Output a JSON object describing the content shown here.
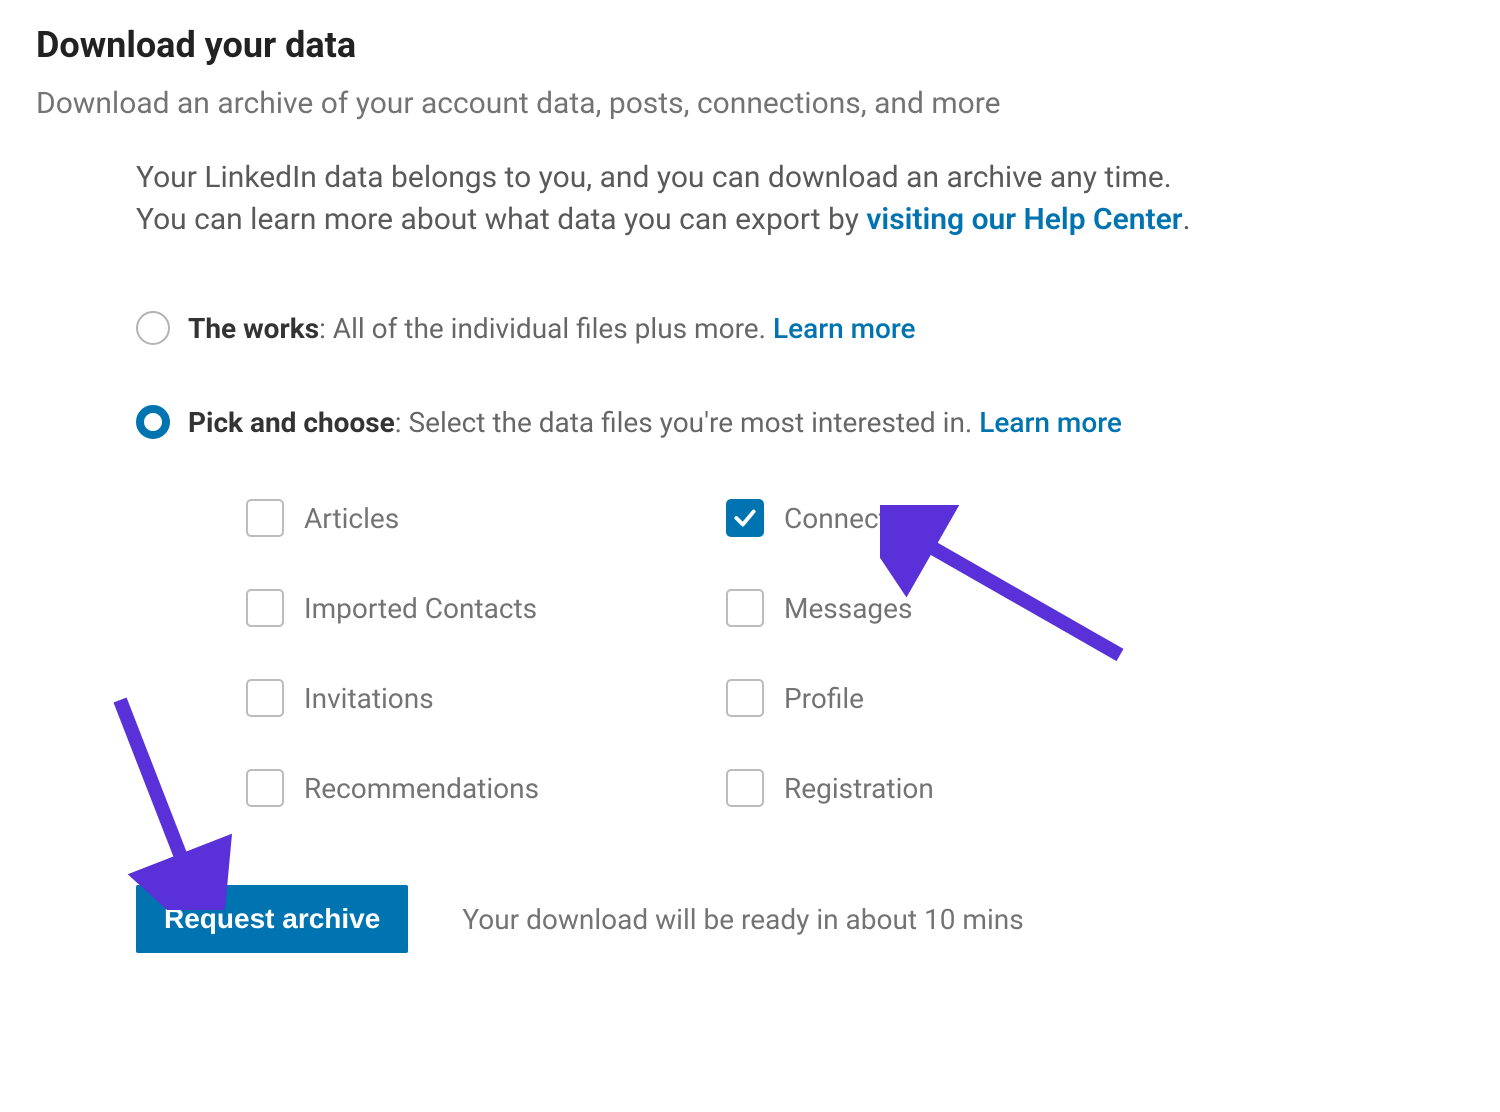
{
  "title": "Download your data",
  "subtitle": "Download an archive of your account data, posts, connections, and more",
  "intro_prefix": "Your LinkedIn data belongs to you, and you can download an archive any time. You can learn more about what data you can export by ",
  "intro_link": "visiting our Help Center",
  "intro_suffix": ".",
  "options": {
    "works": {
      "label_bold": "The works",
      "label_rest": ": All of the individual files plus more. ",
      "learn_more": "Learn more",
      "selected": false
    },
    "pick": {
      "label_bold": "Pick and choose",
      "label_rest": ": Select the data files you're most interested in. ",
      "learn_more": "Learn more",
      "selected": true
    }
  },
  "checkboxes": [
    {
      "label": "Articles",
      "checked": false
    },
    {
      "label": "Connections",
      "checked": true
    },
    {
      "label": "Imported Contacts",
      "checked": false
    },
    {
      "label": "Messages",
      "checked": false
    },
    {
      "label": "Invitations",
      "checked": false
    },
    {
      "label": "Profile",
      "checked": false
    },
    {
      "label": "Recommendations",
      "checked": false
    },
    {
      "label": "Registration",
      "checked": false
    }
  ],
  "request_button": "Request archive",
  "footer_note": "Your download will be ready in about 10 mins",
  "annotations": {
    "arrow_color": "#5a31d8"
  }
}
